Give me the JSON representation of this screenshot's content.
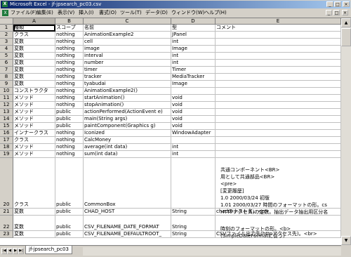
{
  "window": {
    "title": "Microsoft Excel - jf-jpsearch_pc03.csv",
    "app_icon": "X"
  },
  "menu": {
    "items": [
      "ファイル(F)",
      "編集(E)",
      "表示(V)",
      "挿入(I)",
      "書式(O)",
      "ツール(T)",
      "データ(D)",
      "ウィンドウ(W)",
      "ヘルプ(H)"
    ]
  },
  "columns": [
    "A",
    "B",
    "C",
    "D",
    "E"
  ],
  "rows": [
    {
      "n": "1",
      "cells": [
        "種類",
        "スコープ",
        "名前",
        "型",
        "コメント"
      ]
    },
    {
      "n": "2",
      "cells": [
        "クラス",
        "nothing",
        "AnimationExample2",
        "JPanel",
        ""
      ]
    },
    {
      "n": "3",
      "cells": [
        "変数",
        "nothing",
        "cell",
        "int",
        ""
      ]
    },
    {
      "n": "4",
      "cells": [
        "変数",
        "nothing",
        "image",
        "Image",
        ""
      ]
    },
    {
      "n": "5",
      "cells": [
        "変数",
        "nothing",
        "interval",
        "int",
        ""
      ]
    },
    {
      "n": "6",
      "cells": [
        "変数",
        "nothing",
        "number",
        "int",
        ""
      ]
    },
    {
      "n": "7",
      "cells": [
        "変数",
        "nothing",
        "timer",
        "Timer",
        ""
      ]
    },
    {
      "n": "8",
      "cells": [
        "変数",
        "nothing",
        "tracker",
        "MediaTracker",
        ""
      ]
    },
    {
      "n": "9",
      "cells": [
        "変数",
        "nothing",
        "tyabudai",
        "Image",
        ""
      ]
    },
    {
      "n": "10",
      "cells": [
        "コンストラクタ",
        "nothing",
        "AnimationExample2()",
        "",
        ""
      ]
    },
    {
      "n": "11",
      "cells": [
        "メソッド",
        "nothing",
        "startAnimation()",
        "void",
        ""
      ]
    },
    {
      "n": "12",
      "cells": [
        "メソッド",
        "nothing",
        "stopAnimation()",
        "void",
        ""
      ]
    },
    {
      "n": "13",
      "cells": [
        "メソッド",
        "public",
        "actionPerformed(ActionEvent e)",
        "void",
        ""
      ]
    },
    {
      "n": "14",
      "cells": [
        "メソッド",
        "public",
        "main(String args)",
        "void",
        ""
      ]
    },
    {
      "n": "15",
      "cells": [
        "メソッド",
        "public",
        "paintComponent(Graphics g)",
        "void",
        ""
      ]
    },
    {
      "n": "16",
      "cells": [
        "インナークラス",
        "nothing",
        "Iconized",
        "WindowAdapter",
        ""
      ]
    },
    {
      "n": "17",
      "cells": [
        "クラス",
        "nothing",
        "CalcMoney",
        "",
        ""
      ]
    },
    {
      "n": "18",
      "cells": [
        "メソッド",
        "nothing",
        "average(int data)",
        "int",
        ""
      ]
    },
    {
      "n": "19",
      "cells": [
        "メソッド",
        "nothing",
        "sum(int data)",
        "int",
        ""
      ]
    },
    {
      "n": "20",
      "cells": [
        "クラス",
        "public",
        "CommonBox",
        "",
        ""
      ]
    },
    {
      "n": "21",
      "cells": [
        "変数",
        "public",
        "CHAD_HOST",
        "String",
        "chadのホスト名。<p>"
      ]
    },
    {
      "n": "22",
      "cells": [
        "変数",
        "public",
        "CSV_FILENAME_DATE_FORMAT",
        "String",
        ""
      ]
    },
    {
      "n": "23",
      "cells": [
        "変数",
        "public",
        "CSV_FILENAME_DEFAULTROOT_",
        "String",
        "CSVファイル出力先(httpアクセス先)。<br>"
      ]
    }
  ],
  "row20_comment": [
    "共通コンポーネント<BR>",
    "用として共通部品<BR>",
    "<pre>",
    "[変更履歴]",
    "1.0   2000/03/24   初版",
    "1.01  2000/03/27   時間のフォーマットの形。cs",
    "HTTPアクセス)の定数。抽出データ抽出用区分名"
  ],
  "row22_comment": [
    "時刻のフォーマットの形。<b>",
    "(SimpleDateFormatに従う)"
  ],
  "sheet_tab": "jf-jpsearch_pc03",
  "icons": {
    "minimize": "_",
    "maximize": "□",
    "close": "×",
    "scroll_up": "▲",
    "scroll_down": "▼",
    "nav_first": "|◀",
    "nav_prev": "◀",
    "nav_next": "▶",
    "nav_last": "▶|"
  },
  "colors": {
    "title_start": "#0a246a",
    "title_end": "#a6caf0",
    "chrome": "#d4d0c8"
  }
}
